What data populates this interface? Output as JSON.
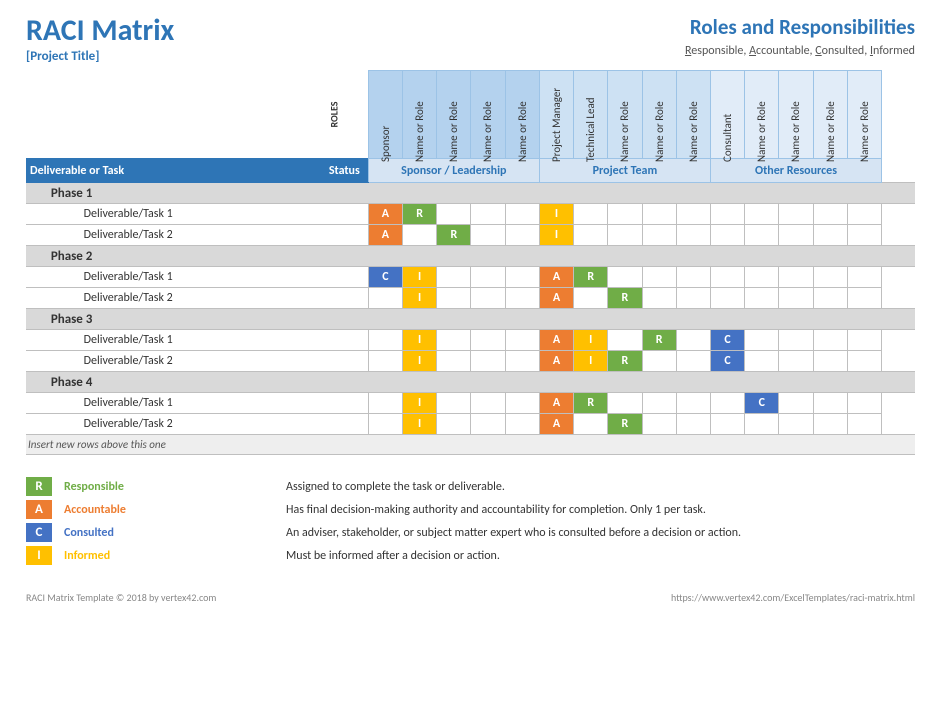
{
  "header": {
    "title": "RACI Matrix",
    "subtitle": "[Project Title]",
    "right_title": "Roles and Responsibilities",
    "right_subtitle_parts": {
      "r": "R",
      "r2": "esponsible, ",
      "a": "A",
      "a2": "ccountable, ",
      "c": "C",
      "c2": "onsulted, ",
      "i": "I",
      "i2": "nformed"
    }
  },
  "roles_label": "ROLES",
  "role_groups": [
    {
      "name": "Sponsor / Leadership",
      "roles": [
        "Sponsor",
        "Name or Role",
        "Name or Role",
        "Name or Role",
        "Name or Role"
      ],
      "shade": "shade1"
    },
    {
      "name": "Project Team",
      "roles": [
        "Project Manager",
        "Technical Lead",
        "Name or Role",
        "Name or Role",
        "Name or Role"
      ],
      "shade": "shade2"
    },
    {
      "name": "Other Resources",
      "roles": [
        "Consultant",
        "Name or Role",
        "Name or Role",
        "Name or Role",
        "Name or Role"
      ],
      "shade": "shade3"
    }
  ],
  "band": {
    "task": "Deliverable or Task",
    "status": "Status"
  },
  "phases": [
    {
      "name": "Phase 1",
      "tasks": [
        {
          "name": "Deliverable/Task 1",
          "cells": [
            "A",
            "R",
            "",
            "",
            "",
            "I",
            "",
            "",
            "",
            "",
            "",
            "",
            "",
            "",
            ""
          ]
        },
        {
          "name": "Deliverable/Task 2",
          "cells": [
            "A",
            "",
            "R",
            "",
            "",
            "I",
            "",
            "",
            "",
            "",
            "",
            "",
            "",
            "",
            ""
          ]
        }
      ]
    },
    {
      "name": "Phase 2",
      "tasks": [
        {
          "name": "Deliverable/Task 1",
          "cells": [
            "C",
            "I",
            "",
            "",
            "",
            "A",
            "R",
            "",
            "",
            "",
            "",
            "",
            "",
            "",
            ""
          ]
        },
        {
          "name": "Deliverable/Task 2",
          "cells": [
            "",
            "I",
            "",
            "",
            "",
            "A",
            "",
            "R",
            "",
            "",
            "",
            "",
            "",
            "",
            ""
          ]
        }
      ]
    },
    {
      "name": "Phase 3",
      "tasks": [
        {
          "name": "Deliverable/Task 1",
          "cells": [
            "",
            "I",
            "",
            "",
            "",
            "A",
            "I",
            "",
            "R",
            "",
            "C",
            "",
            "",
            "",
            ""
          ]
        },
        {
          "name": "Deliverable/Task 2",
          "cells": [
            "",
            "I",
            "",
            "",
            "",
            "A",
            "I",
            "R",
            "",
            "",
            "C",
            "",
            "",
            "",
            ""
          ]
        }
      ]
    },
    {
      "name": "Phase 4",
      "tasks": [
        {
          "name": "Deliverable/Task 1",
          "cells": [
            "",
            "I",
            "",
            "",
            "",
            "A",
            "R",
            "",
            "",
            "",
            "",
            "C",
            "",
            "",
            ""
          ]
        },
        {
          "name": "Deliverable/Task 2",
          "cells": [
            "",
            "I",
            "",
            "",
            "",
            "A",
            "",
            "R",
            "",
            "",
            "",
            "",
            "",
            "",
            ""
          ]
        }
      ]
    }
  ],
  "insert_hint": "Insert new rows above this one",
  "legend": [
    {
      "code": "R",
      "label": "Responsible",
      "desc": "Assigned to complete the task or deliverable."
    },
    {
      "code": "A",
      "label": "Accountable",
      "desc": "Has final decision-making authority and accountability for completion. Only 1 per task."
    },
    {
      "code": "C",
      "label": "Consulted",
      "desc": "An adviser, stakeholder, or subject matter expert who is consulted before a decision or action."
    },
    {
      "code": "I",
      "label": "Informed",
      "desc": "Must be informed after a decision or action."
    }
  ],
  "footer": {
    "left": "RACI Matrix Template © 2018 by vertex42.com",
    "right": "https://www.vertex42.com/ExcelTemplates/raci-matrix.html"
  }
}
